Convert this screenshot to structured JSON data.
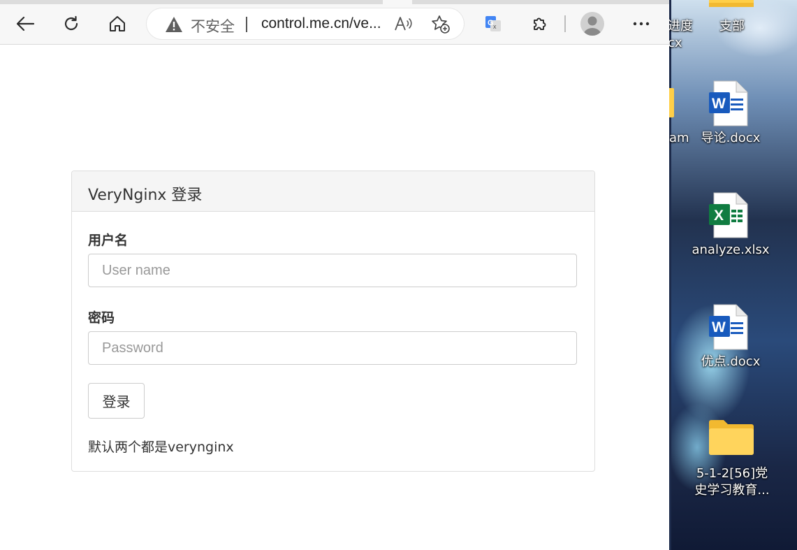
{
  "browser": {
    "address_bar": {
      "security_label": "不安全",
      "url": "control.me.cn/ve..."
    }
  },
  "login_panel": {
    "title": "VeryNginx 登录",
    "username_label": "用户名",
    "username_placeholder": "User name",
    "password_label": "密码",
    "password_placeholder": "Password",
    "submit_label": "登录",
    "hint": "默认两个都是verynginx"
  },
  "desktop": {
    "icons": [
      {
        "label_line1": "进度",
        "label_line2": "cx",
        "icon": "document-icon"
      },
      {
        "label": "支部",
        "icon": "folder-icon"
      },
      {
        "label": "am",
        "icon": "folder-icon"
      },
      {
        "label": "导论.docx",
        "icon": "word-document-icon"
      },
      {
        "label": "analyze.xlsx",
        "icon": "excel-document-icon"
      },
      {
        "label": "优点.docx",
        "icon": "word-document-icon"
      },
      {
        "label_line1": "5-1-2[56]党",
        "label_line2": "史学习教育...",
        "icon": "folder-icon"
      }
    ]
  },
  "colors": {
    "panel_heading_bg": "#f5f5f5",
    "panel_border": "#dddddd",
    "word_blue": "#185abd",
    "excel_green": "#107c41",
    "folder_yellow": "#ffcf48"
  }
}
